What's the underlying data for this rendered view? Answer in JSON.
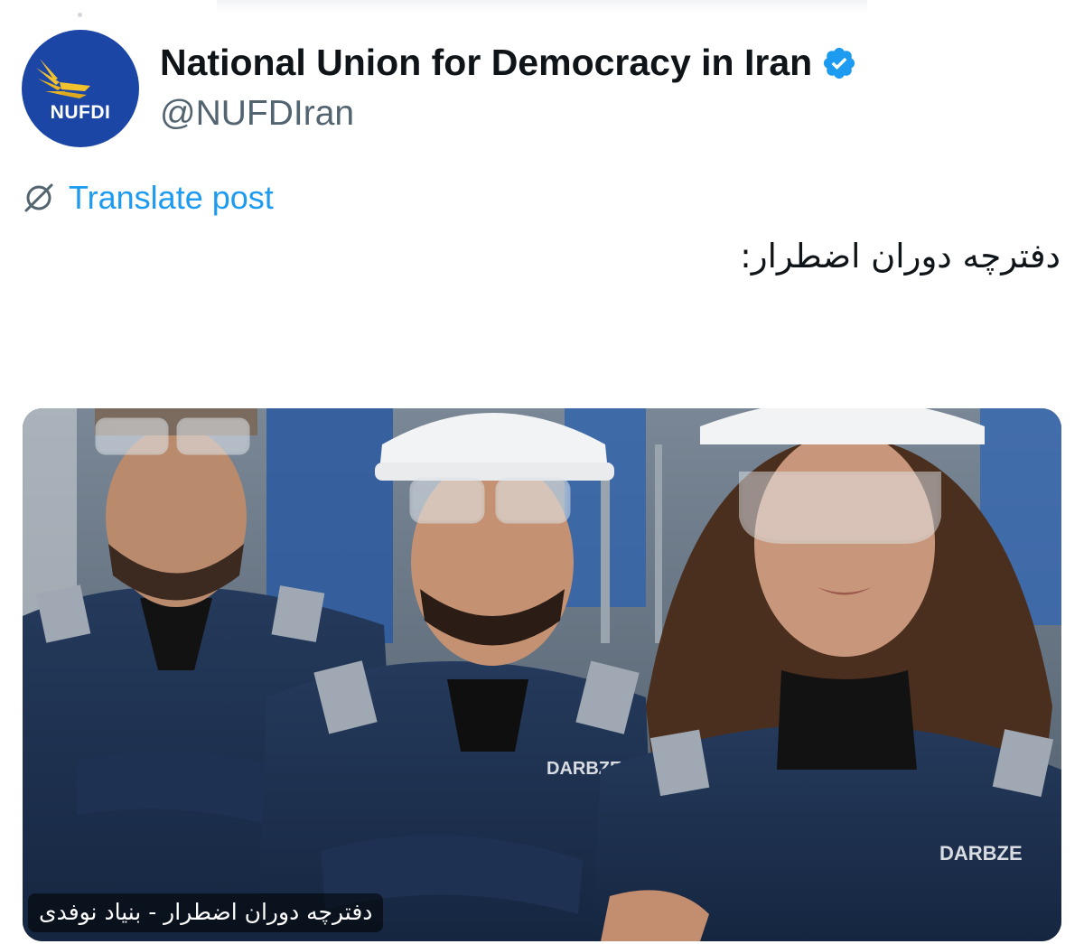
{
  "account": {
    "display_name": "National Union for Democracy in Iran",
    "handle": "@NUFDIran",
    "avatar_text": "NUFDI",
    "verified_icon": "verified-badge-icon",
    "brand_color": "#1b46a6",
    "verified_color": "#1d9bf0"
  },
  "translate": {
    "icon": "globe-slash-icon",
    "label": "Translate post",
    "color": "#1d9bf0"
  },
  "post": {
    "text": "دفترچه دوران اضطرار:"
  },
  "media": {
    "caption": "دفترچه دوران اضطرار - بنیاد نوفدی",
    "badge_text": "DARBZE"
  }
}
